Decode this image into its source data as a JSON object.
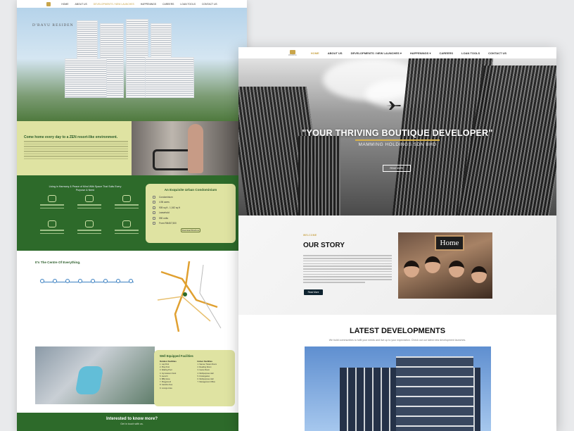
{
  "left_page": {
    "nav": [
      "HOME",
      "ABOUT US",
      "DEVELOPMENTS / NEW LAUNCHES",
      "HAPPENINGS",
      "CAREERS",
      "LOAN TOOLS",
      "CONTACT US"
    ],
    "brand": "D'BAYU RESIDEN",
    "intro_heading": "Come home every day to a ZEN resort-like environment.",
    "amenities_title": "Living in Harmony & Peace of Mind With Space That Suits Every Purpose & Need",
    "card": {
      "title": "An Exquisite Urban Condominium",
      "rows": [
        "Condominium",
        "4.96 acres",
        "905 sq ft - 1,042 sq ft",
        "Leasehold",
        "590 units",
        "From RM457,500"
      ],
      "button": "Download Brochure"
    },
    "map_title": "It's The Centre Of Everything.",
    "facilities": {
      "title": "Well Equipped Facilities",
      "outdoor_title": "Outdoor Facilities",
      "outdoor": [
        "1. Lap Pool",
        "2. Play Pool",
        "3. Wading Pool",
        "4. Gymnasium Deck",
        "5. Jacuzzi",
        "6. BBQ Area",
        "7. Playground",
        "8. Gazebo Area",
        "9. Lounge Area"
      ],
      "indoor_title": "Indoor Facilities",
      "indoor": [
        "1. Sauna / Steam Room",
        "2. Reading Room",
        "3. Game Room",
        "4. Multipurpose Hall",
        "5. Kindergarten",
        "6. Multipurpose Hall",
        "7. Management Office"
      ]
    },
    "footer": {
      "title": "Interested to know more?",
      "subtitle": "Get in touch with us."
    }
  },
  "right_page": {
    "logo_text": "MAMMING",
    "nav": [
      {
        "label": "HOME",
        "active": true
      },
      {
        "label": "ABOUT US",
        "active": false
      },
      {
        "label": "DEVELOPMENTS / NEW LAUNCHES",
        "active": false
      },
      {
        "label": "HAPPENINGS",
        "active": false
      },
      {
        "label": "CAREERS",
        "active": false
      },
      {
        "label": "LOAN TOOLS",
        "active": false
      },
      {
        "label": "CONTACT US",
        "active": false
      }
    ],
    "hero": {
      "title": "\"YOUR THRIVING BOUTIQUE DEVELOPER\"",
      "subtitle": "MAMMING HOLDINGS SDN BHD",
      "button": "READ MORE"
    },
    "story": {
      "welcome": "WELCOME",
      "title": "OUR STORY",
      "button": "Read More",
      "photo_sign": "Home"
    },
    "latest": {
      "title": "LATEST DEVELOPMENTS",
      "subtitle": "We build communities to fulfil your needs and live up to your expectation. Check out our latest new development launches."
    }
  },
  "colors": {
    "gold": "#c9a54a",
    "green": "#2d6a2a",
    "lime": "#dfe3a2",
    "dark": "#0f2430"
  }
}
